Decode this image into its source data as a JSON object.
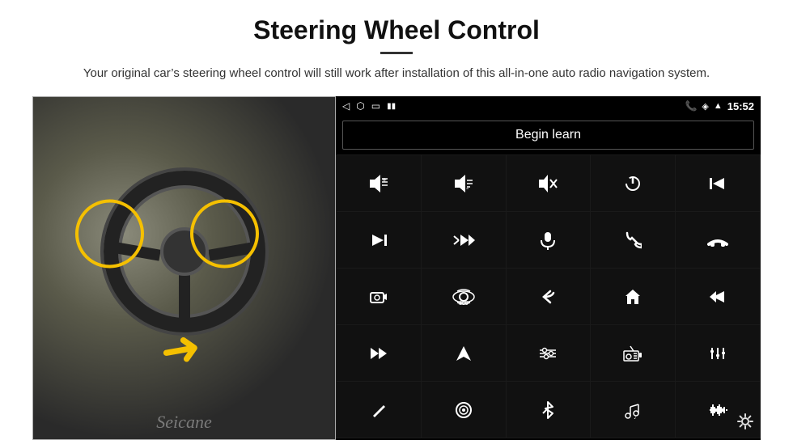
{
  "header": {
    "title": "Steering Wheel Control",
    "subtitle": "Your original car’s steering wheel control will still work after installation of this all-in-one auto radio navigation system.",
    "divider": true
  },
  "statusBar": {
    "left": [
      "back-icon",
      "home-icon",
      "recents-icon",
      "signal-icon"
    ],
    "time": "15:52",
    "icons": [
      "phone-icon",
      "location-icon",
      "wifi-icon"
    ]
  },
  "beginLearn": {
    "label": "Begin learn"
  },
  "controls": [
    {
      "icon": "🔊+",
      "name": "vol-up"
    },
    {
      "icon": "🔊-",
      "name": "vol-down"
    },
    {
      "icon": "🔇",
      "name": "mute"
    },
    {
      "icon": "⏻",
      "name": "power"
    },
    {
      "icon": "⏮",
      "name": "prev-track"
    },
    {
      "icon": "⏭",
      "name": "next-track"
    },
    {
      "icon": "✕⏭",
      "name": "skip-fwd"
    },
    {
      "icon": "🎤",
      "name": "mic"
    },
    {
      "icon": "📞",
      "name": "call"
    },
    {
      "icon": "↩",
      "name": "hang-up"
    },
    {
      "icon": "📢",
      "name": "horn"
    },
    {
      "icon": "⚙360",
      "name": "cam-360"
    },
    {
      "icon": "↩",
      "name": "back"
    },
    {
      "icon": "🏠",
      "name": "home"
    },
    {
      "icon": "⏮⏮",
      "name": "prev"
    },
    {
      "icon": "⏭⏭",
      "name": "ff"
    },
    {
      "icon": "▶",
      "name": "nav"
    },
    {
      "icon": "⇌",
      "name": "toggle"
    },
    {
      "icon": "📻",
      "name": "radio"
    },
    {
      "icon": "🎚",
      "name": "eq"
    },
    {
      "icon": "✏",
      "name": "edit"
    },
    {
      "icon": "⏺",
      "name": "record"
    },
    {
      "icon": "🔵",
      "name": "bluetooth"
    },
    {
      "icon": "🎵",
      "name": "music"
    },
    {
      "icon": "📊",
      "name": "audio"
    }
  ],
  "seicane": {
    "text": "Seicane"
  },
  "settings": {
    "icon": "⚙"
  }
}
